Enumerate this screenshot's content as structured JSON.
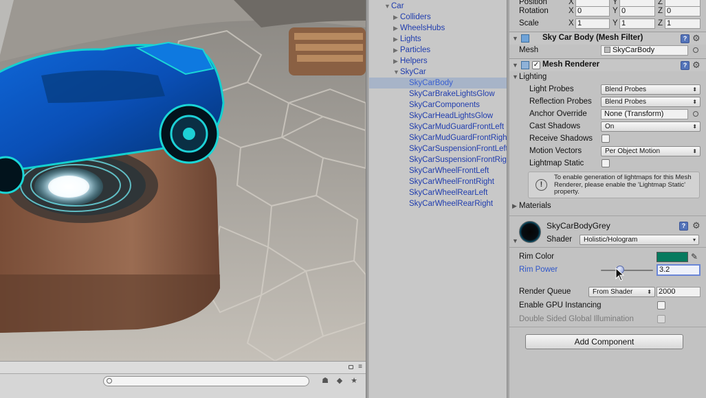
{
  "scene": {
    "toolbar_icons": [
      "layers-icon",
      "tag-icon",
      "star-icon"
    ]
  },
  "hierarchy": {
    "items": [
      {
        "label": "Car",
        "depth": 0,
        "expanded": true
      },
      {
        "label": "Colliders",
        "depth": 1,
        "expanded": false
      },
      {
        "label": "WheelsHubs",
        "depth": 1,
        "expanded": false
      },
      {
        "label": "Lights",
        "depth": 1,
        "expanded": false
      },
      {
        "label": "Particles",
        "depth": 1,
        "expanded": false
      },
      {
        "label": "Helpers",
        "depth": 1,
        "expanded": false
      },
      {
        "label": "SkyCar",
        "depth": 1,
        "expanded": true
      },
      {
        "label": "SkyCarBody",
        "depth": 2,
        "selected": true
      },
      {
        "label": "SkyCarBrakeLightsGlow",
        "depth": 2
      },
      {
        "label": "SkyCarComponents",
        "depth": 2
      },
      {
        "label": "SkyCarHeadLightsGlow",
        "depth": 2
      },
      {
        "label": "SkyCarMudGuardFrontLeft",
        "depth": 2
      },
      {
        "label": "SkyCarMudGuardFrontRight",
        "depth": 2
      },
      {
        "label": "SkyCarSuspensionFrontLeft",
        "depth": 2
      },
      {
        "label": "SkyCarSuspensionFrontRight",
        "depth": 2
      },
      {
        "label": "SkyCarWheelFrontLeft",
        "depth": 2
      },
      {
        "label": "SkyCarWheelFrontRight",
        "depth": 2
      },
      {
        "label": "SkyCarWheelRearLeft",
        "depth": 2
      },
      {
        "label": "SkyCarWheelRearRight",
        "depth": 2
      }
    ]
  },
  "inspector": {
    "transform": {
      "position_label": "Position",
      "rotation_label": "Rotation",
      "rotation": {
        "x": "0",
        "y": "0",
        "z": "0"
      },
      "scale_label": "Scale",
      "scale": {
        "x": "1",
        "y": "1",
        "z": "1"
      },
      "axis_x": "X",
      "axis_y": "Y",
      "axis_z": "Z"
    },
    "mesh_filter": {
      "title": "Sky Car Body (Mesh Filter)",
      "mesh_label": "Mesh",
      "mesh_value": "SkyCarBody"
    },
    "mesh_renderer": {
      "title": "Mesh Renderer",
      "enabled": true,
      "lighting_label": "Lighting",
      "light_probes_label": "Light Probes",
      "light_probes_value": "Blend Probes",
      "reflection_probes_label": "Reflection Probes",
      "reflection_probes_value": "Blend Probes",
      "anchor_override_label": "Anchor Override",
      "anchor_override_value": "None (Transform)",
      "cast_shadows_label": "Cast Shadows",
      "cast_shadows_value": "On",
      "receive_shadows_label": "Receive Shadows",
      "receive_shadows": false,
      "motion_vectors_label": "Motion Vectors",
      "motion_vectors_value": "Per Object Motion",
      "lightmap_static_label": "Lightmap Static",
      "lightmap_static": false,
      "help_text": "To enable generation of lightmaps for this Mesh Renderer, please enable the 'Lightmap Static' property.",
      "materials_label": "Materials"
    },
    "material": {
      "name": "SkyCarBodyGrey",
      "shader_label": "Shader",
      "shader_value": "Holistic/Hologram",
      "rim_color_label": "Rim Color",
      "rim_color": "#067a5e",
      "rim_power_label": "Rim Power",
      "rim_power_value": "3.2",
      "rim_power_fraction": 0.35,
      "render_queue_label": "Render Queue",
      "render_queue_mode": "From Shader",
      "render_queue_value": "2000",
      "gpu_instancing_label": "Enable GPU Instancing",
      "double_sided_label": "Double Sided Global Illumination"
    },
    "add_component_label": "Add Component"
  },
  "colors": {
    "hierarchy_text": "#1f3cae",
    "selection": "#a7b4c8",
    "accent": "#5474b9"
  }
}
